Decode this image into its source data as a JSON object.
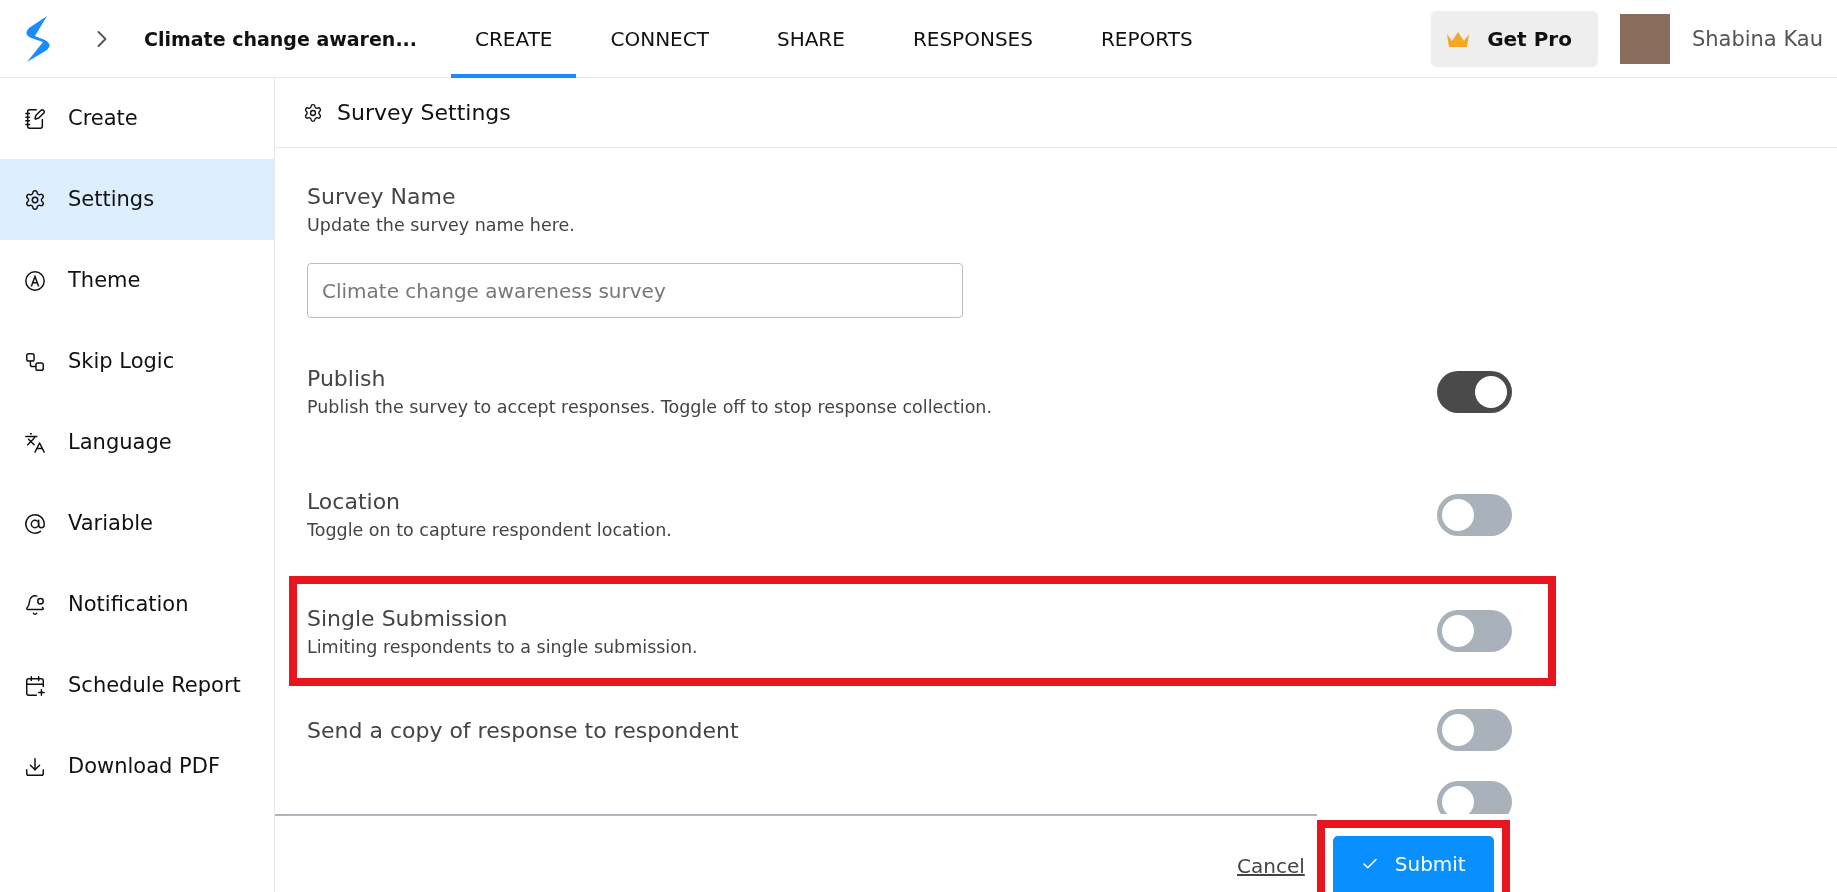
{
  "header": {
    "survey_title": "Climate change awaren...",
    "tabs": [
      {
        "label": "CREATE",
        "selected": true
      },
      {
        "label": "CONNECT",
        "selected": false
      },
      {
        "label": "SHARE",
        "selected": false
      },
      {
        "label": "RESPONSES",
        "selected": false
      },
      {
        "label": "REPORTS",
        "selected": false
      }
    ],
    "pro_button": "Get Pro",
    "user_name": "Shabina Kau"
  },
  "sidebar": {
    "items": [
      {
        "label": "Create",
        "selected": false
      },
      {
        "label": "Settings",
        "selected": true
      },
      {
        "label": "Theme",
        "selected": false
      },
      {
        "label": "Skip Logic",
        "selected": false
      },
      {
        "label": "Language",
        "selected": false
      },
      {
        "label": "Variable",
        "selected": false
      },
      {
        "label": "Notification",
        "selected": false
      },
      {
        "label": "Schedule Report",
        "selected": false
      },
      {
        "label": "Download PDF",
        "selected": false
      }
    ]
  },
  "panel": {
    "title": "Survey Settings",
    "settings": [
      {
        "kind": "text",
        "title": "Survey Name",
        "description": "Update the survey name here.",
        "placeholder": "Climate change awareness survey",
        "highlighted": false
      },
      {
        "kind": "toggle",
        "title": "Publish",
        "description": "Publish the survey to accept responses. Toggle off to stop response collection.",
        "on": true,
        "highlighted": false
      },
      {
        "kind": "toggle",
        "title": "Location",
        "description": "Toggle on to capture respondent location.",
        "on": false,
        "highlighted": false
      },
      {
        "kind": "toggle",
        "title": "Single Submission",
        "description": "Limiting respondents to a single submission.",
        "on": false,
        "highlighted": true
      },
      {
        "kind": "toggle",
        "title": "Send a copy of response to respondent",
        "on": false,
        "highlighted": false
      },
      {
        "kind": "toggle",
        "on": false,
        "highlighted": false
      }
    ]
  },
  "footer": {
    "cancel": "Cancel",
    "submit": "Submit",
    "submit_highlighted": true
  }
}
